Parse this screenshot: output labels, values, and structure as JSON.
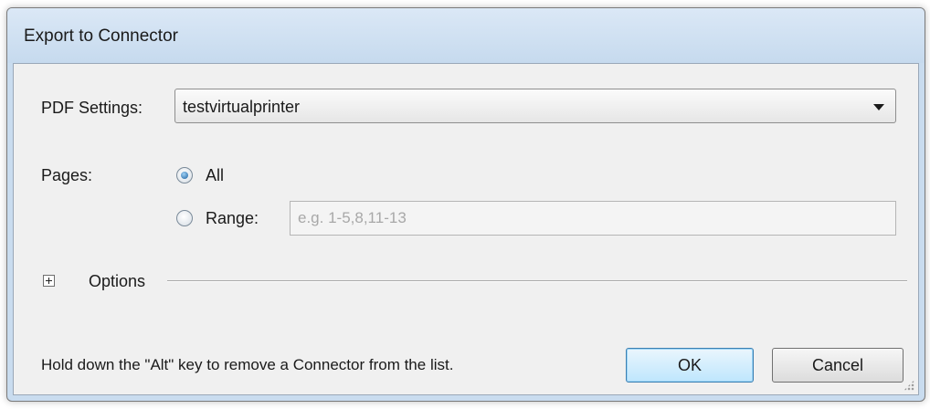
{
  "window": {
    "title": "Export to Connector"
  },
  "pdf_settings": {
    "label": "PDF Settings:",
    "selected": "testvirtualprinter"
  },
  "pages": {
    "label": "Pages:",
    "all_label": "All",
    "range_label": "Range:",
    "range_value": "",
    "range_placeholder": "e.g. 1-5,8,11-13",
    "selected": "All"
  },
  "options": {
    "label": "Options",
    "expanded": false
  },
  "hint": "Hold down the \"Alt\" key to remove a Connector from the list.",
  "buttons": {
    "ok": "OK",
    "cancel": "Cancel"
  }
}
